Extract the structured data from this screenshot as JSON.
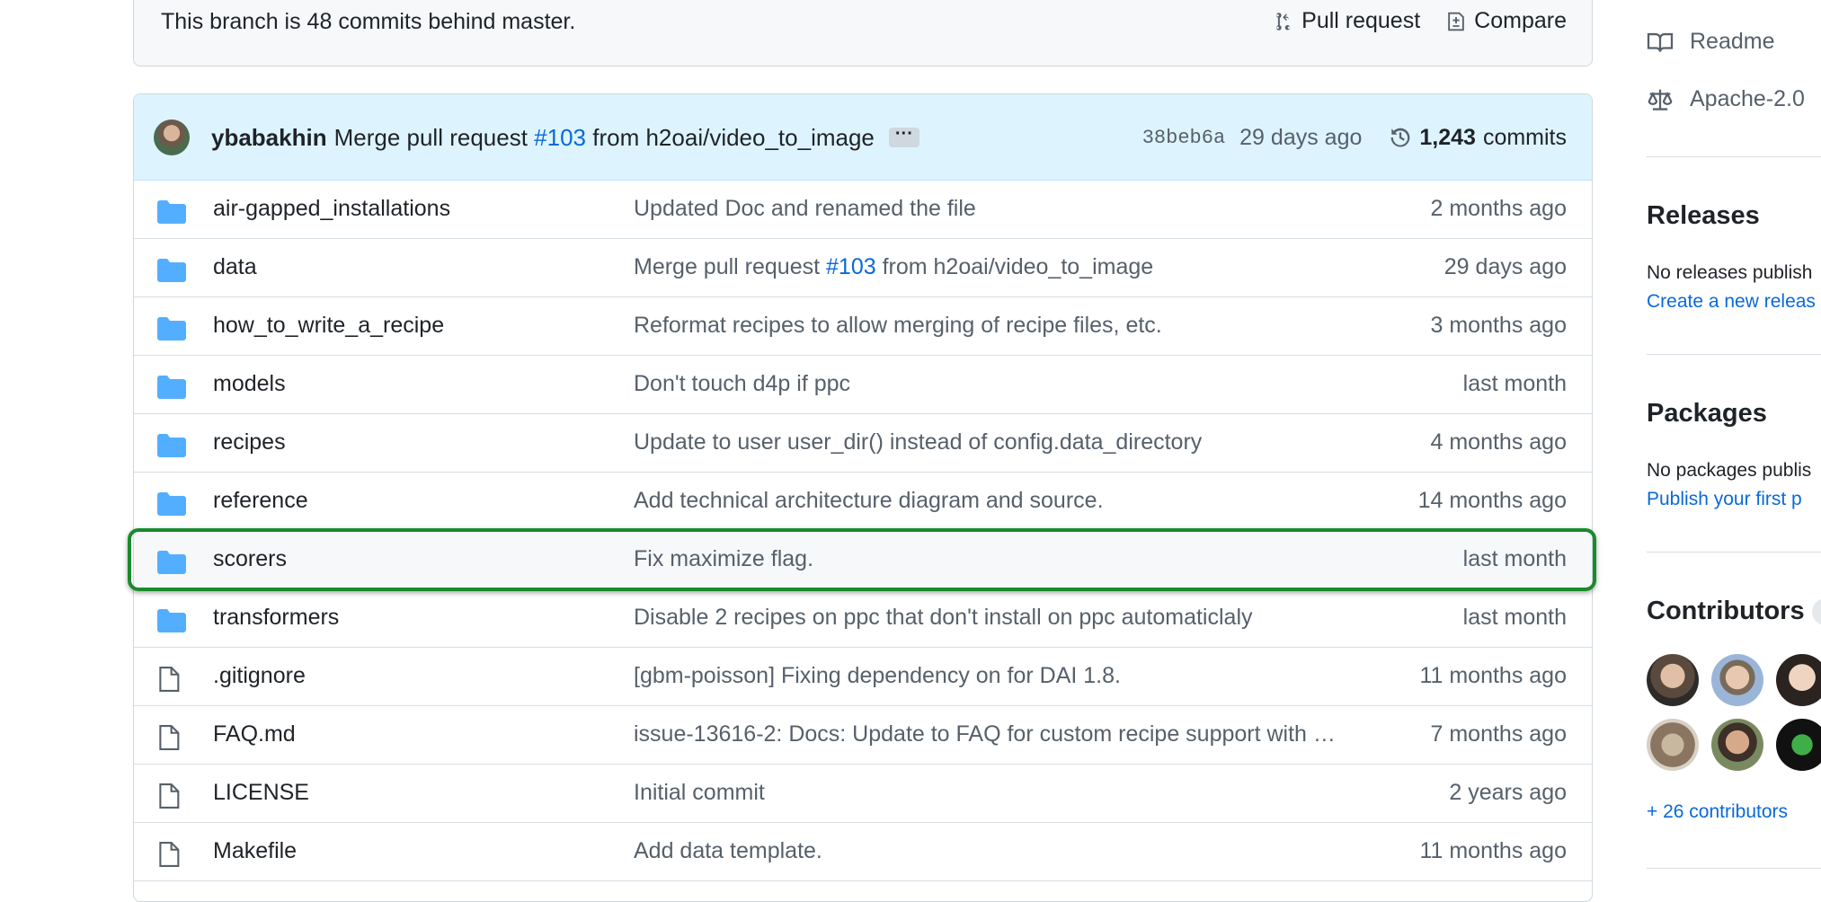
{
  "banner": {
    "text": "This branch is 48 commits behind master.",
    "pull_request": "Pull request",
    "compare": "Compare"
  },
  "latest_commit": {
    "author": "ybabakhin",
    "message_prefix": "Merge pull request",
    "pr": "#103",
    "message_suffix": "from h2oai/video_to_image",
    "ellipsis": "···",
    "sha": "38beb6a",
    "age": "29 days ago",
    "commit_count": "1,243",
    "commits_label": "commits"
  },
  "files": [
    {
      "type": "dir",
      "name": "air-gapped_installations",
      "msg": "Updated Doc and renamed the file",
      "date": "2 months ago"
    },
    {
      "type": "dir",
      "name": "data",
      "msg_prefix": "Merge pull request ",
      "msg_link": "#103",
      "msg_suffix": " from h2oai/video_to_image",
      "date": "29 days ago"
    },
    {
      "type": "dir",
      "name": "how_to_write_a_recipe",
      "msg": "Reformat recipes to allow merging of recipe files, etc.",
      "date": "3 months ago"
    },
    {
      "type": "dir",
      "name": "models",
      "msg": "Don't touch d4p if ppc",
      "date": "last month"
    },
    {
      "type": "dir",
      "name": "recipes",
      "msg": "Update to user user_dir() instead of config.data_directory",
      "date": "4 months ago"
    },
    {
      "type": "dir",
      "name": "reference",
      "msg": "Add technical architecture diagram and source.",
      "date": "14 months ago"
    },
    {
      "type": "dir",
      "name": "scorers",
      "msg": "Fix maximize flag.",
      "date": "last month",
      "highlighted": true
    },
    {
      "type": "dir",
      "name": "transformers",
      "msg": "Disable 2 recipes on ppc that don't install on ppc automaticlaly",
      "date": "last month"
    },
    {
      "type": "file",
      "name": ".gitignore",
      "msg": "[gbm-poisson] Fixing dependency on for DAI 1.8.",
      "date": "11 months ago"
    },
    {
      "type": "file",
      "name": "FAQ.md",
      "msg": "issue-13616-2: Docs: Update to FAQ for custom recipe support with …",
      "date": "7 months ago"
    },
    {
      "type": "file",
      "name": "LICENSE",
      "msg": "Initial commit",
      "date": "2 years ago"
    },
    {
      "type": "file",
      "name": "Makefile",
      "msg": "Add data template.",
      "date": "11 months ago"
    }
  ],
  "sidebar": {
    "readme": "Readme",
    "license": "Apache-2.0",
    "releases_title": "Releases",
    "releases_text": "No releases publish",
    "releases_link": "Create a new releas",
    "packages_title": "Packages",
    "packages_text": "No packages publis",
    "packages_link": "Publish your first p",
    "contributors_title": "Contributors",
    "contributors_more": "+ 26 contributors"
  },
  "colors": {
    "link": "#0969da",
    "folder": "#54aeff",
    "highlight_border": "#1a8a2a",
    "commit_header_bg": "#ddf4ff"
  }
}
